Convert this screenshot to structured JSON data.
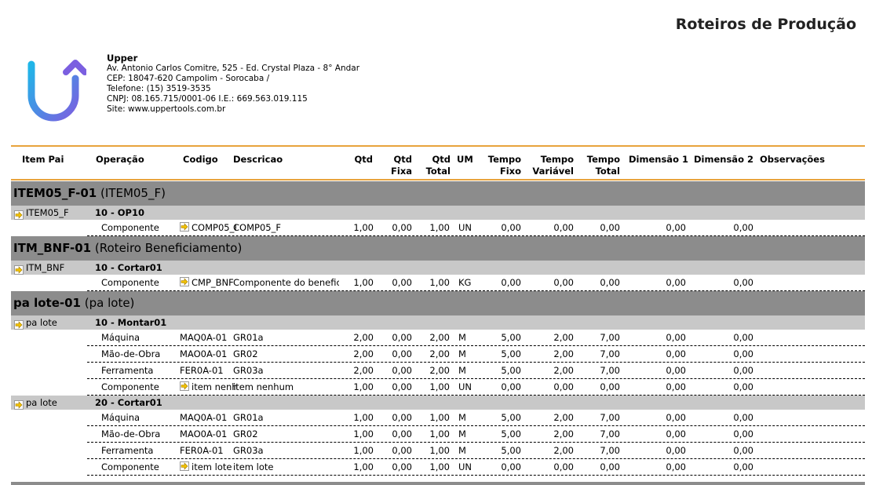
{
  "report": {
    "title": "Roteiros de Produção"
  },
  "company": {
    "name": "Upper",
    "lines": [
      " Av. Antonio Carlos Comitre, 525 - Ed. Crystal Plaza - 8° Andar",
      "CEP: 18047-620 Campolim - Sorocaba /",
      "Telefone: (15) 3519-3535",
      "CNPJ:  08.165.715/0001-06    I.E.:  669.563.019.115",
      "Site: www.uppertools.com.br"
    ]
  },
  "colors": {
    "accent": "#e8a33c",
    "group1": "#8c8c8c",
    "group2": "#c8c8c8",
    "arrow": "#f2c200",
    "logo_blue": "#2f8fe0",
    "logo_purple": "#7b5fe0"
  },
  "icons": {
    "row_arrow": "arrow-right-icon",
    "logo": "upper-logo-icon"
  },
  "columns": [
    {
      "key": "item_pai",
      "label": "Item Pai"
    },
    {
      "key": "operacao",
      "label": "Operação"
    },
    {
      "key": "codigo",
      "label": "Codigo"
    },
    {
      "key": "descricao",
      "label": "Descricao"
    },
    {
      "key": "qtd",
      "label": "Qtd"
    },
    {
      "key": "qtd_fixa",
      "label": "Qtd Fixa"
    },
    {
      "key": "qtd_total",
      "label": "Qtd Total"
    },
    {
      "key": "um",
      "label": "UM"
    },
    {
      "key": "tempo_fixo",
      "label": "Tempo Fixo"
    },
    {
      "key": "tempo_variavel",
      "label": "Tempo Variável"
    },
    {
      "key": "tempo_total",
      "label": "Tempo Total"
    },
    {
      "key": "dimensao1",
      "label": "Dimensão 1"
    },
    {
      "key": "dimensao2",
      "label": "Dimensão 2"
    },
    {
      "key": "observacoes",
      "label": "Observações"
    }
  ],
  "groups": [
    {
      "code": "ITEM05_F-01",
      "name": "(ITEM05_F)",
      "operations": [
        {
          "item": "ITEM05_F",
          "op": "10 - OP10",
          "rows": [
            {
              "tipo": "Componente",
              "arrow": true,
              "codigo": "COMP05_F",
              "descricao": "COMP05_F",
              "qtd": "1,00",
              "qtd_fixa": "0,00",
              "qtd_total": "1,00",
              "um": "UN",
              "tempo_fixo": "0,00",
              "tempo_variavel": "0,00",
              "tempo_total": "0,00",
              "dim1": "0,00",
              "dim2": "0,00"
            }
          ]
        }
      ]
    },
    {
      "code": "ITM_BNF-01",
      "name": "(Roteiro Beneficiamento)",
      "operations": [
        {
          "item": "ITM_BNF",
          "op": "10 - Cortar01",
          "rows": [
            {
              "tipo": "Componente",
              "arrow": true,
              "codigo": "CMP_BNF",
              "descricao": "Componente do benefic",
              "qtd": "1,00",
              "qtd_fixa": "0,00",
              "qtd_total": "1,00",
              "um": "KG",
              "tempo_fixo": "0,00",
              "tempo_variavel": "0,00",
              "tempo_total": "0,00",
              "dim1": "0,00",
              "dim2": "0,00"
            }
          ]
        }
      ]
    },
    {
      "code": "pa lote-01",
      "name": "(pa lote)",
      "operations": [
        {
          "item": "pa lote",
          "op": "10 - Montar01",
          "rows": [
            {
              "tipo": "Máquina",
              "arrow": false,
              "codigo": "MAQ0A-01",
              "descricao": "GR01a",
              "qtd": "2,00",
              "qtd_fixa": "0,00",
              "qtd_total": "2,00",
              "um": "M",
              "tempo_fixo": "5,00",
              "tempo_variavel": "2,00",
              "tempo_total": "7,00",
              "dim1": "0,00",
              "dim2": "0,00"
            },
            {
              "tipo": "Mão-de-Obra",
              "arrow": false,
              "codigo": "MAO0A-01",
              "descricao": "GR02",
              "qtd": "2,00",
              "qtd_fixa": "0,00",
              "qtd_total": "2,00",
              "um": "M",
              "tempo_fixo": "5,00",
              "tempo_variavel": "2,00",
              "tempo_total": "7,00",
              "dim1": "0,00",
              "dim2": "0,00"
            },
            {
              "tipo": "Ferramenta",
              "arrow": false,
              "codigo": "FER0A-01",
              "descricao": "GR03a",
              "qtd": "2,00",
              "qtd_fixa": "0,00",
              "qtd_total": "2,00",
              "um": "M",
              "tempo_fixo": "5,00",
              "tempo_variavel": "2,00",
              "tempo_total": "7,00",
              "dim1": "0,00",
              "dim2": "0,00"
            },
            {
              "tipo": "Componente",
              "arrow": true,
              "codigo": "item nenhu",
              "descricao": "item nenhum",
              "qtd": "1,00",
              "qtd_fixa": "0,00",
              "qtd_total": "1,00",
              "um": "UN",
              "tempo_fixo": "0,00",
              "tempo_variavel": "0,00",
              "tempo_total": "0,00",
              "dim1": "0,00",
              "dim2": "0,00"
            }
          ]
        },
        {
          "item": "pa lote",
          "op": "20 - Cortar01",
          "rows": [
            {
              "tipo": "Máquina",
              "arrow": false,
              "codigo": "MAQ0A-01",
              "descricao": "GR01a",
              "qtd": "1,00",
              "qtd_fixa": "0,00",
              "qtd_total": "1,00",
              "um": "M",
              "tempo_fixo": "5,00",
              "tempo_variavel": "2,00",
              "tempo_total": "7,00",
              "dim1": "0,00",
              "dim2": "0,00"
            },
            {
              "tipo": "Mão-de-Obra",
              "arrow": false,
              "codigo": "MAO0A-01",
              "descricao": "GR02",
              "qtd": "1,00",
              "qtd_fixa": "0,00",
              "qtd_total": "1,00",
              "um": "M",
              "tempo_fixo": "5,00",
              "tempo_variavel": "2,00",
              "tempo_total": "7,00",
              "dim1": "0,00",
              "dim2": "0,00"
            },
            {
              "tipo": "Ferramenta",
              "arrow": false,
              "codigo": "FER0A-01",
              "descricao": "GR03a",
              "qtd": "1,00",
              "qtd_fixa": "0,00",
              "qtd_total": "1,00",
              "um": "M",
              "tempo_fixo": "5,00",
              "tempo_variavel": "2,00",
              "tempo_total": "7,00",
              "dim1": "0,00",
              "dim2": "0,00"
            },
            {
              "tipo": "Componente",
              "arrow": true,
              "codigo": "item lote",
              "descricao": "item lote",
              "qtd": "1,00",
              "qtd_fixa": "0,00",
              "qtd_total": "1,00",
              "um": "UN",
              "tempo_fixo": "0,00",
              "tempo_variavel": "0,00",
              "tempo_total": "0,00",
              "dim1": "0,00",
              "dim2": "0,00"
            }
          ]
        }
      ]
    }
  ]
}
